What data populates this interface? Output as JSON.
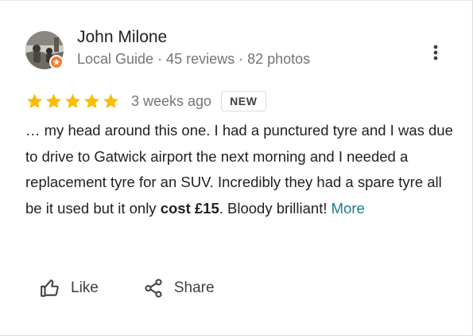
{
  "review": {
    "author": {
      "name": "John Milone",
      "meta": "Local Guide · 45 reviews · 82 photos",
      "avatar_icon": "user-photo-avatar",
      "badge_icon": "local-guide-star-badge",
      "badge_color": "#f57c31"
    },
    "rating": {
      "stars": 5,
      "max_stars": 5,
      "star_color": "#fbbc04"
    },
    "time": "3 weeks ago",
    "badge": "NEW",
    "text": {
      "before_bold": "… my head around this one. I had a punctured tyre and I was due to drive to Gatwick airport the next morning and I needed a replacement tyre for an SUV. Incredibly they had a spare tyre all be it used but it only ",
      "bold": "cost £15",
      "after_bold": ". Bloody brilliant! ",
      "more_label": "More",
      "more_color": "#167e8a"
    },
    "menu_icon": "more-vert-icon"
  },
  "actions": {
    "like_label": "Like",
    "like_icon": "thumbs-up-icon",
    "share_label": "Share",
    "share_icon": "share-icon"
  }
}
